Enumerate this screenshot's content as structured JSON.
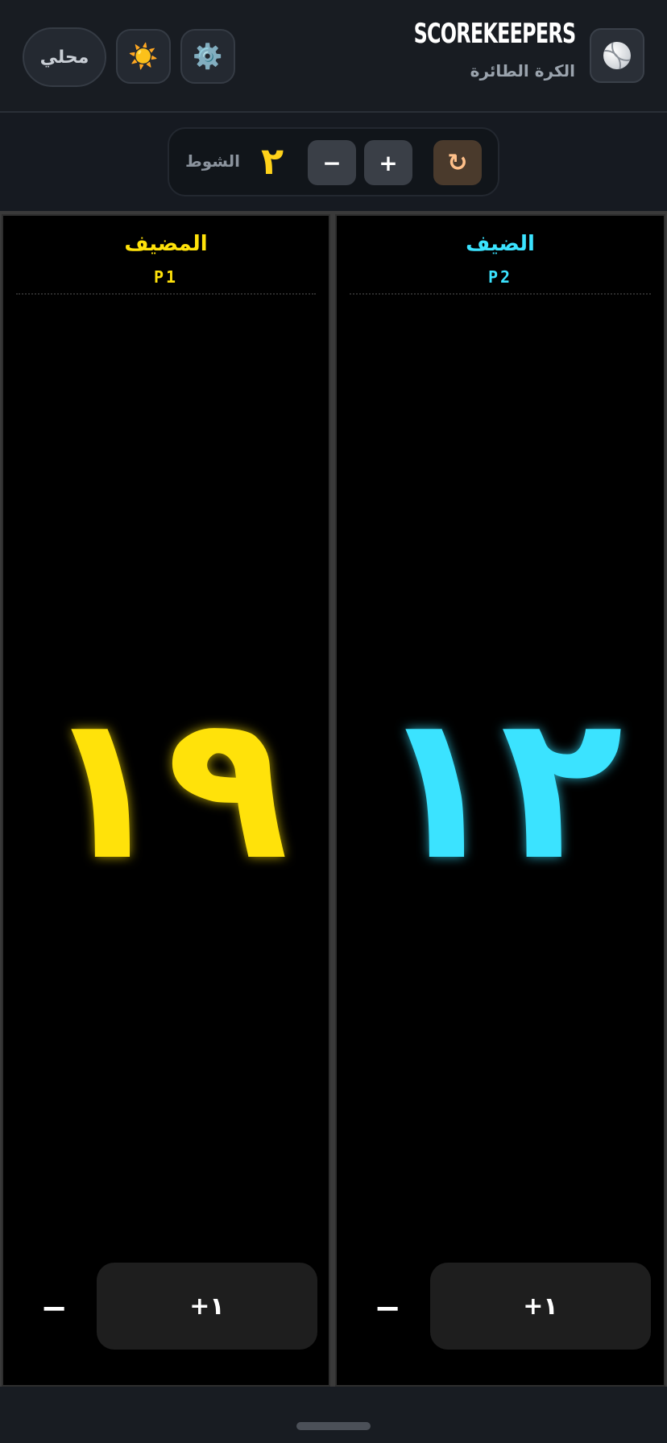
{
  "header": {
    "app_icon": "volleyball-icon",
    "title": "SCOREKEEPERS",
    "subtitle": "الكرة الطائرة",
    "theme_icon": "☀️",
    "settings_icon": "⚙️",
    "mode_label": "محلي"
  },
  "sets": {
    "label": "الشوط",
    "value": "٢",
    "minus_label": "−",
    "plus_label": "+",
    "reset_icon": "↻"
  },
  "teams": {
    "home": {
      "name": "المضيف",
      "tag": "P1",
      "score": "١٩",
      "color": "#ffe20a",
      "decrement_label": "−",
      "increment_label": "+١"
    },
    "away": {
      "name": "الضيف",
      "tag": "P2",
      "score": "١٢",
      "color": "#3be3ff",
      "decrement_label": "−",
      "increment_label": "+١"
    }
  }
}
